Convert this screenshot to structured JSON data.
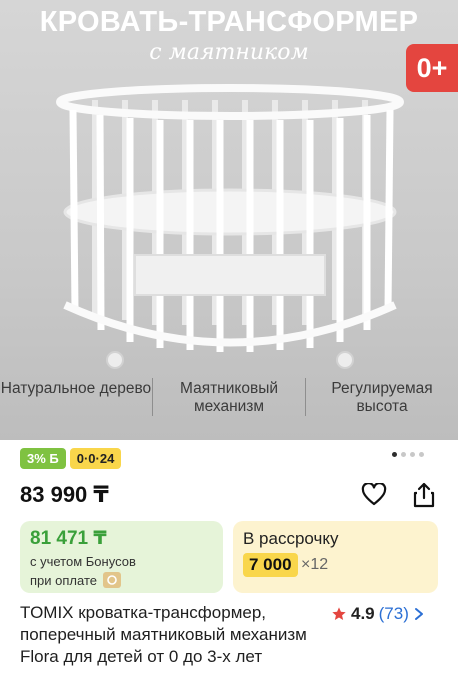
{
  "hero": {
    "title": "КРОВАТЬ-ТРАНСФОРМЕР",
    "subtitle": "с маятником",
    "age_badge": "0+",
    "features": [
      "Натуральное дерево",
      "Маятниковый механизм",
      "Регулируемая высота"
    ]
  },
  "badges": {
    "bonus": "3% Б",
    "installment": "0·0·24"
  },
  "carousel": {
    "total": 4,
    "active": 0
  },
  "price": "83 990 ₸",
  "bonus_card": {
    "price": "81 471 ₸",
    "line1": "с учетом Бонусов",
    "line2": "при оплате"
  },
  "installment_card": {
    "label": "В рассрочку",
    "amount": "7 000",
    "multiplier": "×12"
  },
  "product": {
    "title": "TOMIX кроватка-трансформер, поперечный маятниковый механизм Flora для детей от 0 до 3-х лет",
    "rating": "4.9",
    "reviews": "(73)"
  },
  "icons": {
    "wishlist": "heart-icon",
    "share": "share-icon",
    "star": "star-icon",
    "chevron": "chevron-right-icon"
  },
  "colors": {
    "accent_red": "#e4453f",
    "bonus_green": "#7fc241",
    "installment_yellow": "#f9d64b",
    "link_blue": "#2b6fd4"
  }
}
